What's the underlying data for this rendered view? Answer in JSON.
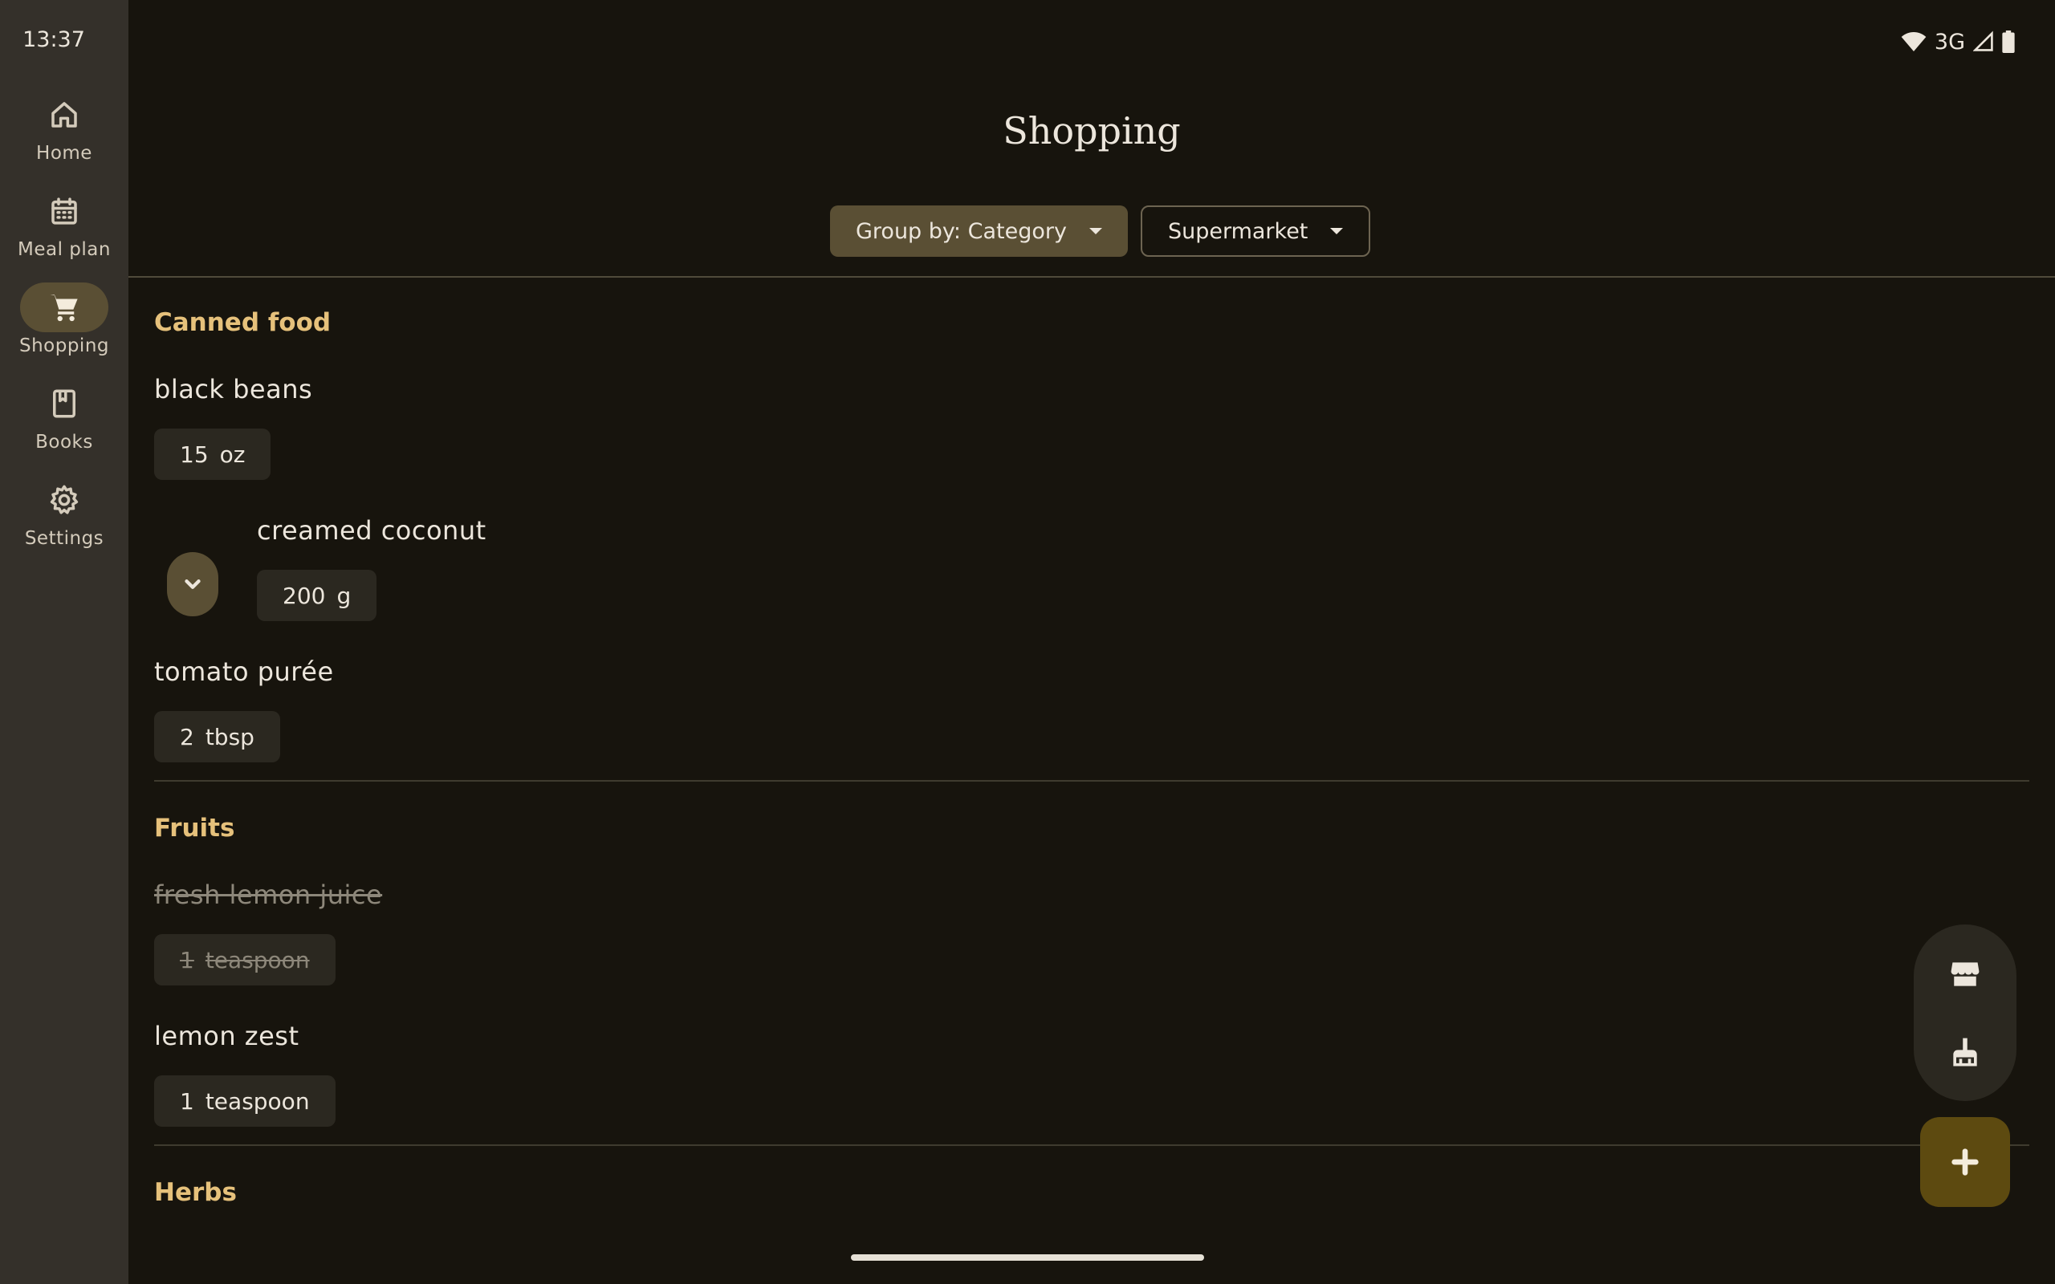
{
  "status": {
    "time": "13:37",
    "network": "3G"
  },
  "nav": {
    "items": [
      {
        "label": "Home",
        "icon": "home-icon"
      },
      {
        "label": "Meal plan",
        "icon": "calendar-icon"
      },
      {
        "label": "Shopping",
        "icon": "cart-icon",
        "active": true
      },
      {
        "label": "Books",
        "icon": "book-icon"
      },
      {
        "label": "Settings",
        "icon": "gear-icon"
      }
    ]
  },
  "header": {
    "title": "Shopping",
    "group_by": "Group by: Category",
    "store": "Supermarket"
  },
  "sections": [
    {
      "title": "Canned food",
      "items": [
        {
          "name": "black beans",
          "amount": "15",
          "unit": "oz",
          "checked": false
        },
        {
          "name": "creamed coconut",
          "amount": "200",
          "unit": "g",
          "checked": false,
          "expandable": true
        },
        {
          "name": "tomato purée",
          "amount": "2",
          "unit": "tbsp",
          "checked": false
        }
      ]
    },
    {
      "title": "Fruits",
      "items": [
        {
          "name": "fresh lemon juice",
          "amount": "1",
          "unit": "teaspoon",
          "checked": true
        },
        {
          "name": "lemon zest",
          "amount": "1",
          "unit": "teaspoon",
          "checked": false
        }
      ]
    },
    {
      "title": "Herbs",
      "items": []
    }
  ],
  "fabs": {
    "store_icon": "store-icon",
    "clear_icon": "broom-icon",
    "add_icon": "plus-icon"
  },
  "colors": {
    "accent": "#e6c17b",
    "background": "#17140d",
    "rail": "#34302a",
    "chip": "#5a4f34"
  }
}
